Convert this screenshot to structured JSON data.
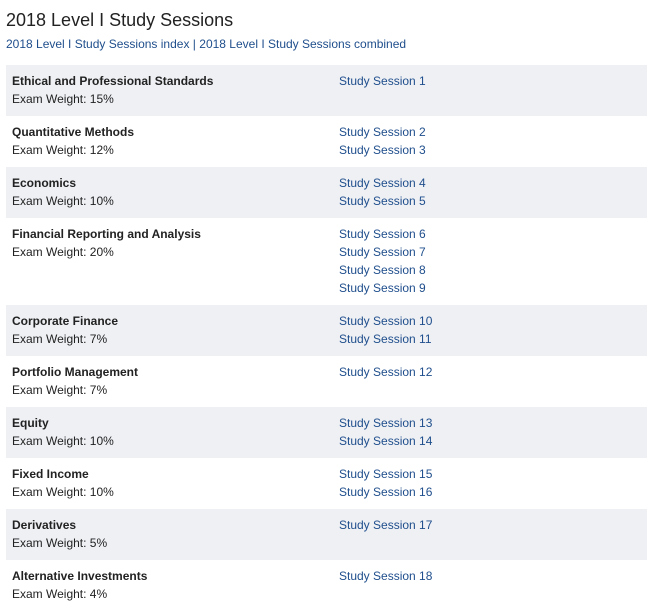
{
  "title": "2018 Level I Study Sessions",
  "links": {
    "index": "2018 Level I Study Sessions index",
    "separator": "|",
    "combined": "2018 Level I Study Sessions combined"
  },
  "rows": [
    {
      "topic": "Ethical and Professional Standards",
      "weight": "Exam Weight: 15%",
      "sessions": [
        "Study Session 1"
      ]
    },
    {
      "topic": "Quantitative Methods",
      "weight": "Exam Weight: 12%",
      "sessions": [
        "Study Session 2",
        "Study Session 3"
      ]
    },
    {
      "topic": "Economics",
      "weight": "Exam Weight: 10%",
      "sessions": [
        "Study Session 4",
        "Study Session 5"
      ]
    },
    {
      "topic": "Financial Reporting and Analysis",
      "weight": "Exam Weight: 20%",
      "sessions": [
        "Study Session 6",
        "Study Session 7",
        "Study Session 8",
        "Study Session 9"
      ]
    },
    {
      "topic": "Corporate Finance",
      "weight": "Exam Weight: 7%",
      "sessions": [
        "Study Session 10",
        "Study Session 11"
      ]
    },
    {
      "topic": "Portfolio Management",
      "weight": "Exam Weight: 7%",
      "sessions": [
        "Study Session 12"
      ]
    },
    {
      "topic": "Equity",
      "weight": "Exam Weight: 10%",
      "sessions": [
        "Study Session 13",
        "Study Session 14"
      ]
    },
    {
      "topic": "Fixed Income",
      "weight": "Exam Weight: 10%",
      "sessions": [
        "Study Session 15",
        "Study Session 16"
      ]
    },
    {
      "topic": "Derivatives",
      "weight": "Exam Weight: 5%",
      "sessions": [
        "Study Session 17"
      ]
    },
    {
      "topic": "Alternative Investments",
      "weight": "Exam Weight: 4%",
      "sessions": [
        "Study Session 18"
      ]
    }
  ]
}
